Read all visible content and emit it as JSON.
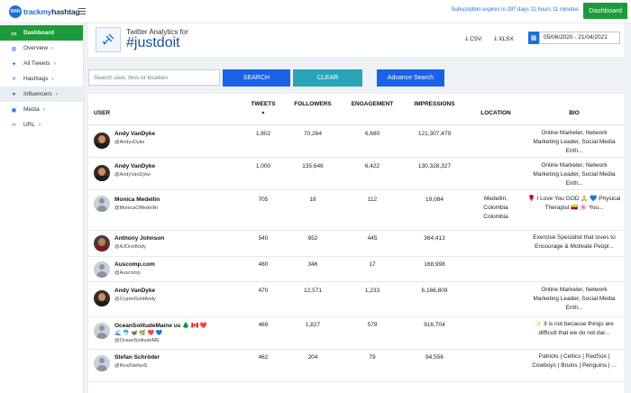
{
  "topbar": {
    "logo_badge": "tmh",
    "logo_a": "trackmy",
    "logo_b": "hashtag",
    "expiry_text": "Subscription expires in 297 days 11 hours 11 minutes",
    "dashboard_button": "Dashboard"
  },
  "sidebar": {
    "items": [
      {
        "label": "Dashboard",
        "icon": "laptop-icon",
        "glyph": "▭"
      },
      {
        "label": "Overview",
        "icon": "globe-icon",
        "glyph": "◍"
      },
      {
        "label": "All Tweets",
        "icon": "twitter-icon",
        "glyph": "✦"
      },
      {
        "label": "Hashtags",
        "icon": "hash-icon",
        "glyph": "#"
      },
      {
        "label": "Influencers",
        "icon": "user-icon",
        "glyph": "●"
      },
      {
        "label": "Media",
        "icon": "image-icon",
        "glyph": "▣"
      },
      {
        "label": "URL",
        "icon": "link-icon",
        "glyph": "∞"
      }
    ],
    "chevron": "›"
  },
  "header": {
    "subtitle": "Twitter Analytics for",
    "hashtag": "#justdoit",
    "csv_label": "CSV",
    "xlsx_label": "XLSX",
    "download_glyph": "⤓",
    "calendar_glyph": "▦",
    "date_range": "05/06/2020 - 21/04/2021"
  },
  "search": {
    "placeholder": "Search user, bios or location",
    "search_button": "SEARCH",
    "clear_button": "CLEAR",
    "advanced_button": "Advance Search"
  },
  "table": {
    "columns": {
      "user": "USER",
      "tweets": "TWEETS",
      "followers": "FOLLOWERS",
      "engagement": "ENGAGEMENT",
      "impressions": "IMPRESSIONS",
      "location": "LOCATION",
      "bio": "BIO"
    },
    "sort_glyph": "▲",
    "rows": [
      {
        "name": "Andy VanDyke",
        "handle": "@AndyvDyke",
        "tweets": "1,802",
        "followers": "70,264",
        "engagement": "6,680",
        "impressions": "121,307,479",
        "location_1": "",
        "location_2": "",
        "location_3": "",
        "bio_1": "Online Marketer, Network",
        "bio_2": "Marketing Leader, Social Media",
        "bio_3": "Enth..."
      },
      {
        "name": "Andy VanDyke",
        "handle": "@AndyVanDyke",
        "tweets": "1,000",
        "followers": "135,646",
        "engagement": "6,422",
        "impressions": "130,328,327",
        "location_1": "",
        "location_2": "",
        "location_3": "",
        "bio_1": "Online Marketer, Network",
        "bio_2": "Marketing Leader, Social Media",
        "bio_3": "Enth..."
      },
      {
        "name": "Monica Medellin",
        "handle": "@MonicaOMedellin",
        "tweets": "705",
        "followers": "18",
        "engagement": "112",
        "impressions": "19,084",
        "location_1": "Medellin,",
        "location_2": "Colombia",
        "location_3": "Colombia",
        "bio_1": "🌹 I Love You GOD 🙏 💙 Physical",
        "bio_2": "Therapist 🇨🇴 🌸 You...",
        "bio_3": ""
      },
      {
        "name": "Anthony Johnson",
        "handle": "@AJOneBody",
        "tweets": "540",
        "followers": "652",
        "engagement": "445",
        "impressions": "364,413",
        "location_1": "",
        "location_2": "",
        "location_3": "",
        "bio_1": "Exercise Specialist that loves to",
        "bio_2": "Encourage & Motivate Peopl...",
        "bio_3": ""
      },
      {
        "name": "Auscomp.com",
        "handle": "@Auscomp",
        "tweets": "480",
        "followers": "346",
        "engagement": "17",
        "impressions": "168,998",
        "location_1": "",
        "location_2": "",
        "location_3": "",
        "bio_1": "",
        "bio_2": "",
        "bio_3": ""
      },
      {
        "name": "Andy VanDyke",
        "handle": "@CryptoGoldAndy",
        "tweets": "470",
        "followers": "12,571",
        "engagement": "1,233",
        "impressions": "6,166,809",
        "location_1": "",
        "location_2": "",
        "location_3": "",
        "bio_1": "Online Marketer, Network",
        "bio_2": "Marketing Leader, Social Media",
        "bio_3": "Enth..."
      },
      {
        "name": "OceanSolitudeMaine us 🌲 🇨🇦 ❤️",
        "name_2": "🌊 🐬 🦋 🌿 ❤️ 💙",
        "handle": "@OceanSolitudeME",
        "tweets": "469",
        "followers": "1,827",
        "engagement": "579",
        "impressions": "916,704",
        "location_1": "",
        "location_2": "",
        "location_3": "",
        "bio_1": "✨ It is not because things are",
        "bio_2": "difficult that we do not dar...",
        "bio_3": ""
      },
      {
        "name": "Stefan Schröder",
        "handle": "@RealStefanS",
        "tweets": "462",
        "followers": "204",
        "engagement": "79",
        "impressions": "94,556",
        "location_1": "",
        "location_2": "",
        "location_3": "",
        "bio_1": "Patriots | Celtics | RedSox |",
        "bio_2": "Cowboys | Bruins | Penguins | ...",
        "bio_3": ""
      }
    ]
  }
}
